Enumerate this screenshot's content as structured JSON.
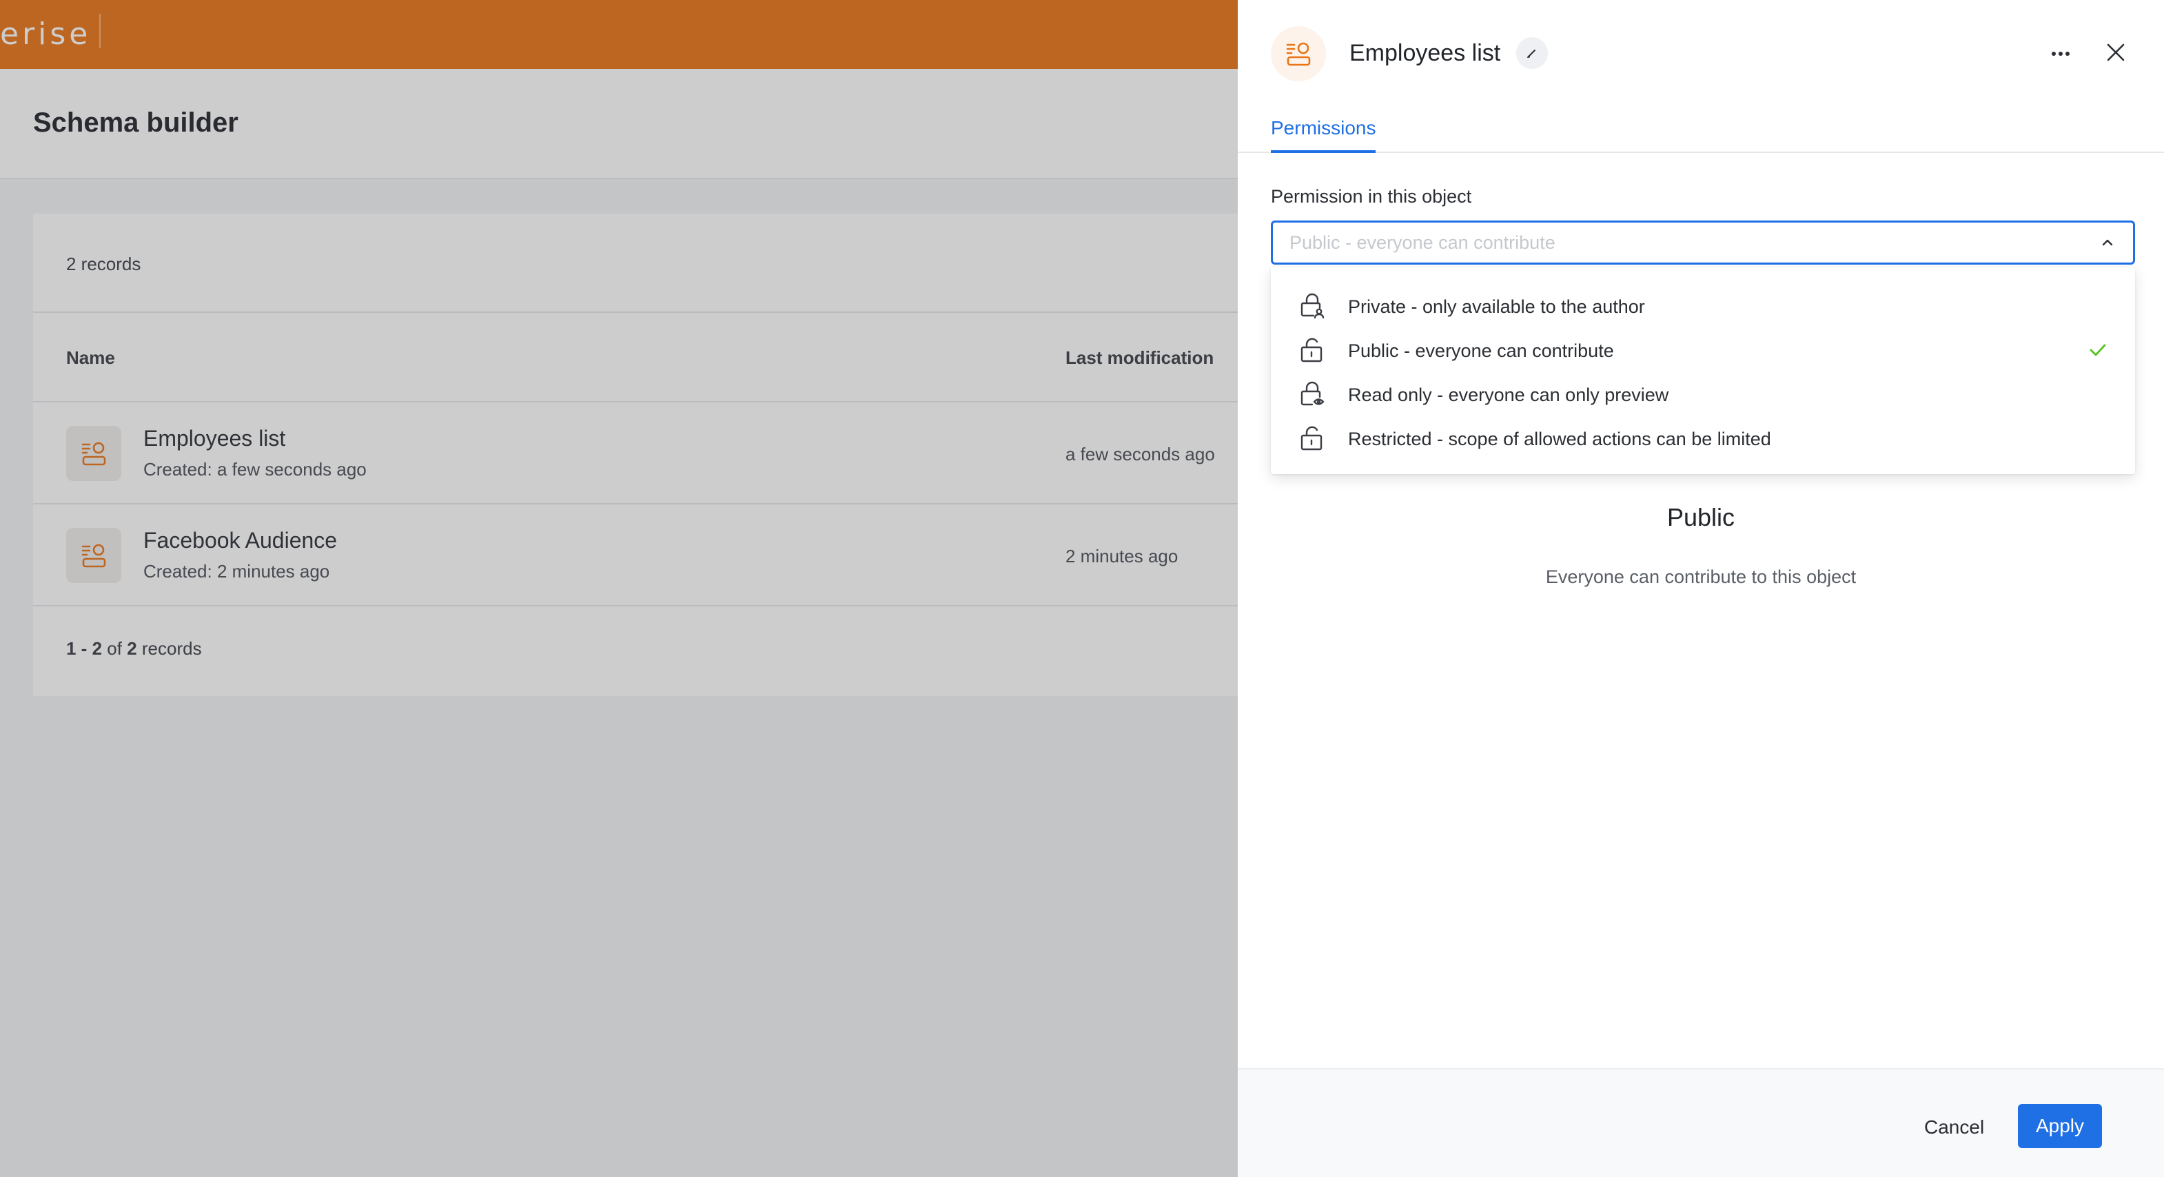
{
  "app": {
    "logo_text": "erise",
    "page_title": "Schema builder",
    "records_count": "2 records",
    "columns": {
      "name": "Name",
      "last_modification": "Last modification"
    },
    "rows": [
      {
        "title": "Employees list",
        "created": "Created: a few seconds ago",
        "modified": "a few seconds ago",
        "icon": "schema-icon"
      },
      {
        "title": "Facebook Audience",
        "created": "Created: 2 minutes ago",
        "modified": "2 minutes ago",
        "icon": "schema-icon"
      }
    ],
    "pager": {
      "range": "1 - 2",
      "of": "of",
      "total": "2",
      "suffix": "records"
    }
  },
  "drawer": {
    "title": "Employees list",
    "tab": "Permissions",
    "field_label": "Permission in this object",
    "select_placeholder": "Public - everyone can contribute",
    "options": [
      {
        "label": "Private - only available to the author",
        "icon": "lock-user-icon",
        "selected": false
      },
      {
        "label": "Public - everyone can contribute",
        "icon": "unlock-icon",
        "selected": true
      },
      {
        "label": "Read only - everyone can only preview",
        "icon": "lock-eye-icon",
        "selected": false
      },
      {
        "label": "Restricted - scope of allowed actions can be limited",
        "icon": "unlock-icon",
        "selected": false
      }
    ],
    "info_title": "Public",
    "info_description": "Everyone can contribute to this object",
    "cancel_label": "Cancel",
    "apply_label": "Apply"
  },
  "colors": {
    "brand_orange": "#e97517",
    "accent_blue": "#1f6fe5",
    "check_green": "#52c41a"
  }
}
